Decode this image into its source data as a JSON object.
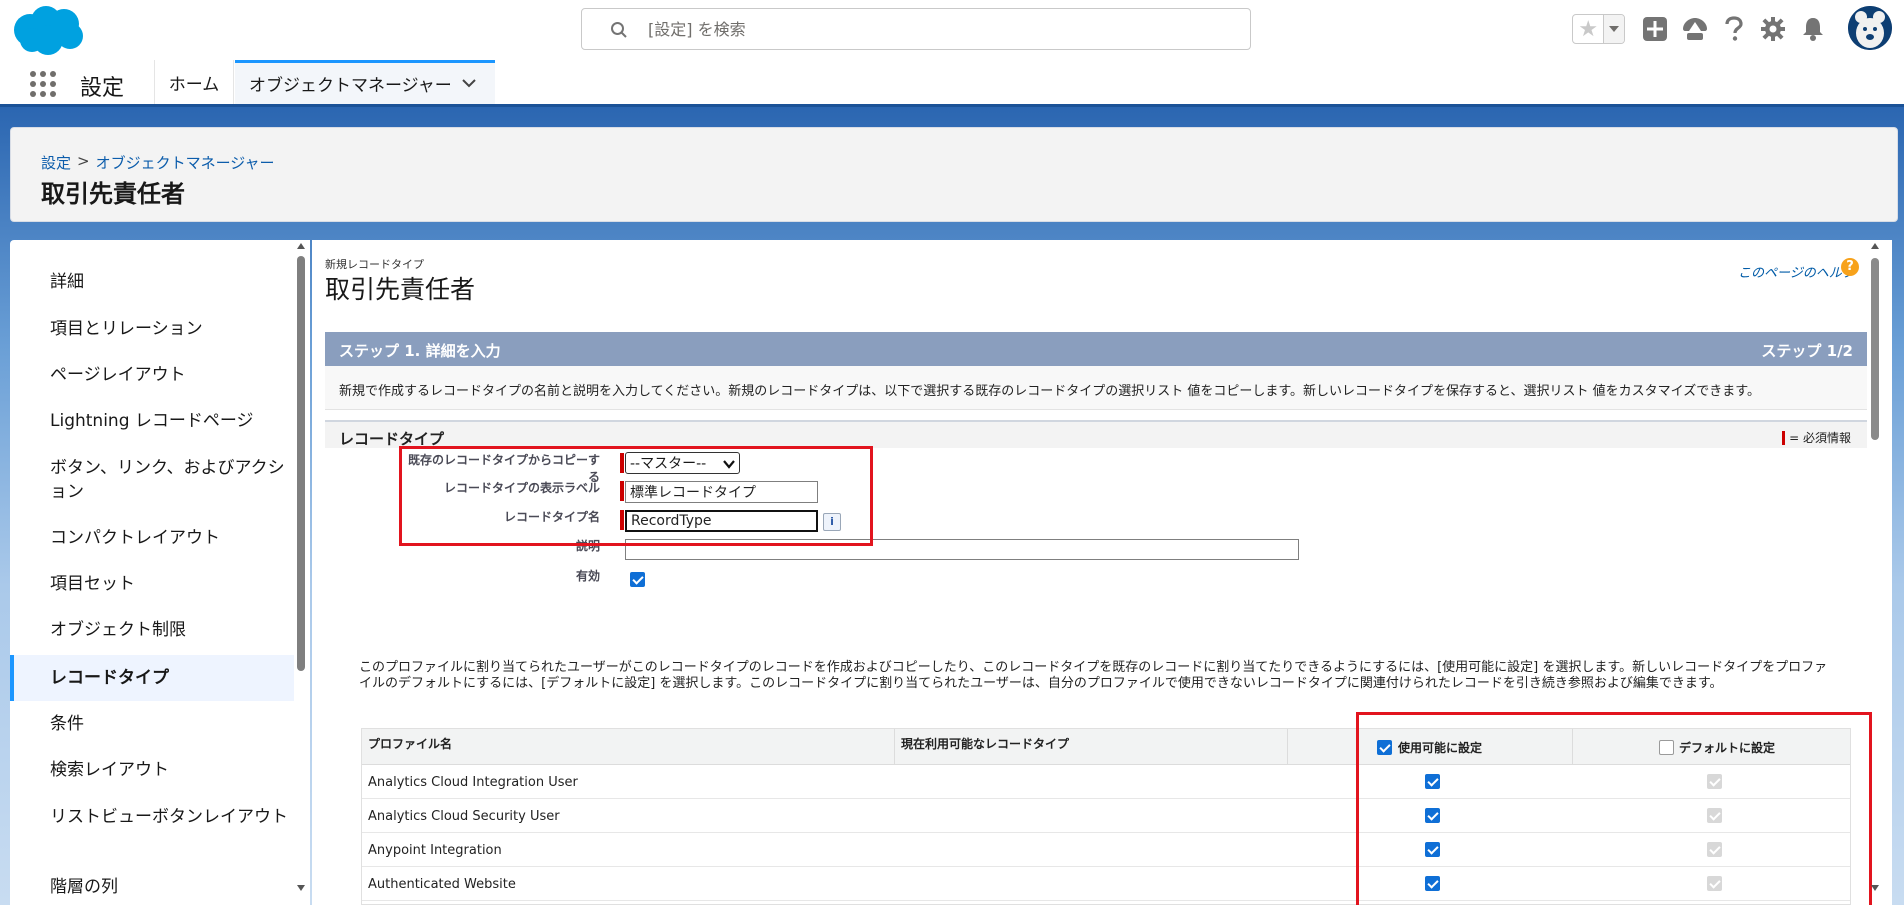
{
  "header": {
    "search_placeholder": "[設定] を検索"
  },
  "context_bar": {
    "app_name": "設定",
    "tabs": [
      {
        "label": "ホーム"
      },
      {
        "label": "オブジェクトマネージャー"
      }
    ]
  },
  "page_header": {
    "breadcrumb": [
      "設定",
      "オブジェクトマネージャー"
    ],
    "breadcrumb_sep": ">",
    "title": "取引先責任者"
  },
  "sidebar": {
    "items": [
      {
        "label": "詳細"
      },
      {
        "label": "項目とリレーション"
      },
      {
        "label": "ページレイアウト"
      },
      {
        "label": "Lightning レコードページ"
      },
      {
        "label": "ボタン、リンク、およびアクション"
      },
      {
        "label": "コンパクトレイアウト"
      },
      {
        "label": "項目セット"
      },
      {
        "label": "オブジェクト制限"
      },
      {
        "label": "レコードタイプ"
      },
      {
        "label": "条件"
      },
      {
        "label": "検索レイアウト"
      },
      {
        "label": "リストビューボタンレイアウト"
      },
      {
        "label": "階層の列"
      }
    ],
    "active_index": 8
  },
  "main": {
    "subtitle": "新規レコードタイプ",
    "title": "取引先責任者",
    "help_link": "このページのヘルプ",
    "step_title": "ステップ 1. 詳細を入力",
    "step_number": "ステップ 1/2",
    "step_description": "新規で作成するレコードタイプの名前と説明を入力してください。新規のレコードタイプは、以下で選択する既存のレコードタイプの選択リスト 値をコピーします。新しいレコードタイプを保存すると、選択リスト 値をカスタマイズできます。",
    "section_title": "レコードタイプ",
    "required_info": "= 必須情報",
    "form": {
      "copy_from_label": "既存のレコードタイプからコピーする",
      "copy_from_value": "--マスター--",
      "display_label_label": "レコードタイプの表示ラベル",
      "display_label_value": "標準レコードタイプ",
      "name_label": "レコードタイプ名",
      "name_value": "RecordType",
      "description_label": "説明",
      "description_value": "",
      "active_label": "有効",
      "active_checked": true
    },
    "profile_description": "このプロファイルに割り当てられたユーザーがこのレコードタイプのレコードを作成およびコピーしたり、このレコードタイプを既存のレコードに割り当てたりできるようにするには、[使用可能に設定] を選択します。新しいレコードタイプをプロファイルのデフォルトにするには、[デフォルトに設定] を選択します。このレコードタイプに割り当てられたユーザーは、自分のプロファイルで使用できないレコードタイプに関連付けられたレコードを引き続き参照および編集できます。",
    "profile_table": {
      "headers": {
        "profile_name": "プロファイル名",
        "current_types": "現在利用可能なレコードタイプ",
        "make_available": "使用可能に設定",
        "make_default": "デフォルトに設定"
      },
      "make_available_all_checked": true,
      "make_default_all_checked": false,
      "rows": [
        {
          "name": "Analytics Cloud Integration User",
          "current": "",
          "available": true,
          "default": false
        },
        {
          "name": "Analytics Cloud Security User",
          "current": "",
          "available": true,
          "default": false
        },
        {
          "name": "Anypoint Integration",
          "current": "",
          "available": true,
          "default": false
        },
        {
          "name": "Authenticated Website",
          "current": "",
          "available": true,
          "default": false
        }
      ]
    }
  },
  "icons": {
    "logo": "salesforce-cloud-logo",
    "search": "search-icon",
    "favorite": "star-icon",
    "add": "plus-icon",
    "trailhead": "trailhead-icon",
    "help": "question-icon",
    "settings": "gear-icon",
    "notifications": "bell-icon",
    "launcher": "app-launcher-icon"
  },
  "colors": {
    "brand": "#00a1e0",
    "accent": "#1b96ff",
    "step_bar": "#8a9ebe",
    "highlight": "#e2141e"
  }
}
